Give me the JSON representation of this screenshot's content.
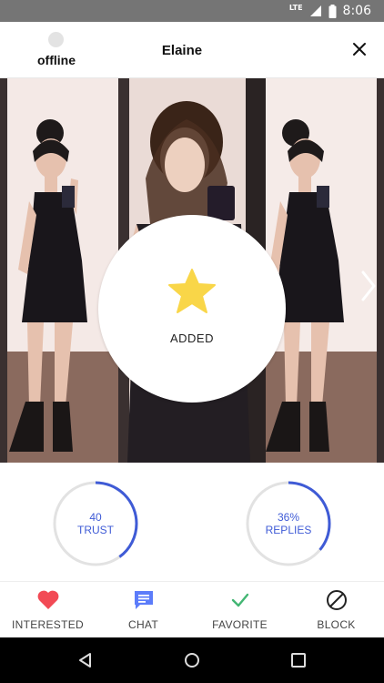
{
  "status_bar": {
    "network": "LTE",
    "time": "8:06"
  },
  "header": {
    "presence": "offline",
    "name": "Elaine",
    "close_icon": "close-icon"
  },
  "photo": {
    "overlay_label": "ADDED",
    "overlay_icon": "star-icon",
    "next_icon": "chevron-right-icon"
  },
  "stats": {
    "trust": {
      "value": "40",
      "label": "TRUST",
      "fraction": 0.4
    },
    "replies": {
      "value": "36%",
      "label": "REPLIES",
      "fraction": 0.36
    }
  },
  "actions": [
    {
      "label": "INTERESTED",
      "icon": "heart-icon",
      "color": "#f24a55"
    },
    {
      "label": "CHAT",
      "icon": "chat-icon",
      "color": "#5c7cfa"
    },
    {
      "label": "FAVORITE",
      "icon": "check-icon",
      "color": "#43b673"
    },
    {
      "label": "BLOCK",
      "icon": "block-icon",
      "color": "#222222"
    }
  ],
  "colors": {
    "accent": "#3f5bd6",
    "ring_track": "#e2e2e2",
    "star": "#f9d648"
  }
}
